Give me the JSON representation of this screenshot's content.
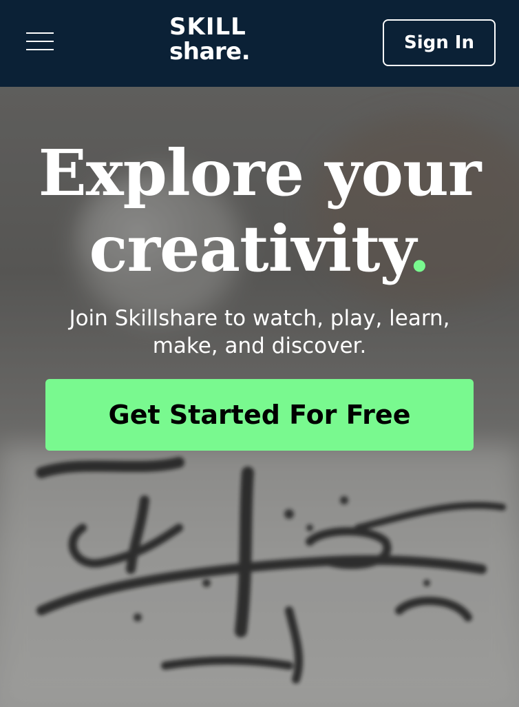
{
  "header": {
    "logo_line1": "SKILL",
    "logo_line2": "share.",
    "signin_label": "Sign In",
    "menu_icon": "hamburger-menu-icon"
  },
  "hero": {
    "headline_line1": "Explore your",
    "headline_line2": "creativity",
    "headline_dot": ".",
    "subtitle": "Join Skillshare to watch, play, learn, make, and discover.",
    "cta_label": "Get Started For Free"
  },
  "colors": {
    "header_bg": "#0b2136",
    "accent_green": "#79f98f",
    "text_white": "#ffffff"
  }
}
